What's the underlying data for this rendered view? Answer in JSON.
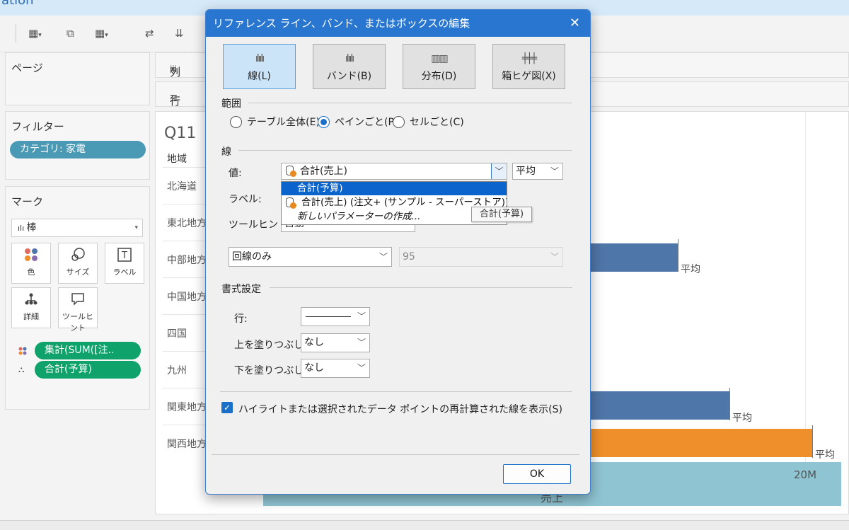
{
  "app": {
    "title_fragment": "ation"
  },
  "panels": {
    "pages_title": "ページ",
    "filters_title": "フィルター",
    "filter_pill": "カテゴリ: 家電",
    "marks_title": "マーク",
    "mark_type": "棒",
    "mark_buttons": [
      {
        "icon": "color-icon",
        "label": "色"
      },
      {
        "icon": "size-icon",
        "label": "サイズ"
      },
      {
        "icon": "label-icon",
        "label": "ラベル"
      },
      {
        "icon": "detail-icon",
        "label": "詳細"
      },
      {
        "icon": "tooltip-icon",
        "label": "ツールヒント"
      }
    ],
    "mark_pills": [
      "集計(SUM([注..",
      "合計(予算)"
    ]
  },
  "shelves": {
    "columns_label": "列",
    "rows_label": "行"
  },
  "view": {
    "title": "Q11",
    "region_header": "地域",
    "regions": [
      "北海道",
      "東北地方",
      "中部地方",
      "中国地方",
      "四国",
      "九州",
      "関東地方",
      "関西地方"
    ],
    "ref_label": "平均",
    "axis_tick": "20M",
    "axis_title": "売上"
  },
  "colors": {
    "blue_bar": "#4f76a8",
    "orange_bar": "#ef8f2b",
    "teal_band": "#8fc4d2",
    "green_pill": "#0fa36b",
    "filter_pill": "#4a9ab5",
    "dialog_title": "#2876d0"
  },
  "dialog": {
    "title": "リファレンス ライン、バンド、またはボックスの編集",
    "types": [
      {
        "label": "線(L)",
        "selected": true
      },
      {
        "label": "バンド(B)",
        "selected": false
      },
      {
        "label": "分布(D)",
        "selected": false
      },
      {
        "label": "箱ヒゲ図(X)",
        "selected": false
      }
    ],
    "scope_title": "範囲",
    "scope_options": [
      {
        "label": "テーブル全体(E)",
        "checked": false
      },
      {
        "label": "ペインごと(P)",
        "checked": true
      },
      {
        "label": "セルごと(C)",
        "checked": false
      }
    ],
    "line_title": "線",
    "value_label": "値:",
    "value_selected": "合計(売上)",
    "aggregation": "平均",
    "dropdown_items": [
      "合計(予算)",
      "合計(売上) (注文+ (サンプル - スーパーストア))",
      "新しいパラメーターの作成..."
    ],
    "hover_tooltip": "合計(予算)",
    "label_label": "ラベル:",
    "tooltip_label": "ツールヒント:",
    "tooltip_value": "自動",
    "ci_select": "回線のみ",
    "ci_value": "95",
    "format_title": "書式設定",
    "format_line_label": "行:",
    "fill_above_label": "上を塗りつぶし:",
    "fill_above_value": "なし",
    "fill_below_label": "下を塗りつぶし:",
    "fill_below_value": "なし",
    "highlight_label": "ハイライトまたは選択されたデータ ポイントの再計算された線を表示(S)",
    "highlight_checked": true,
    "ok_label": "OK"
  }
}
